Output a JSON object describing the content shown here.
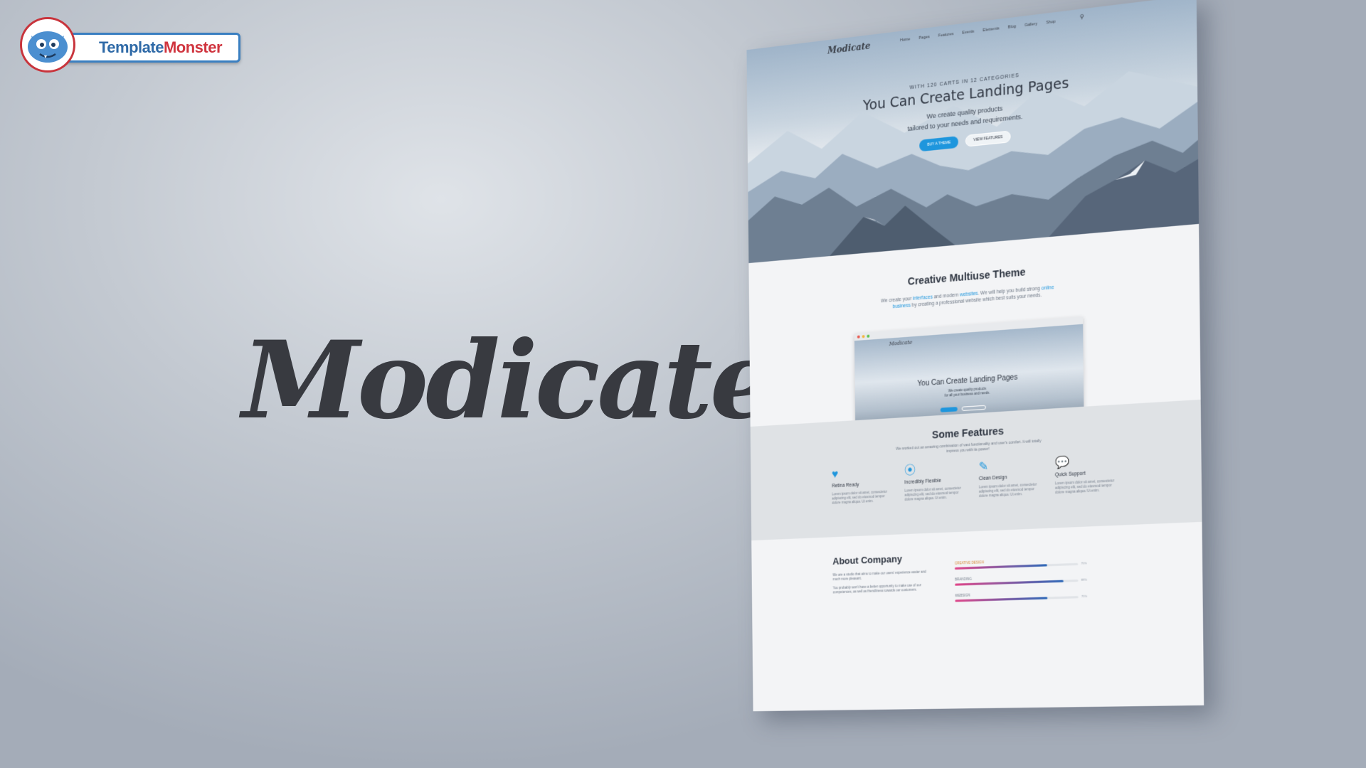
{
  "logo": {
    "part1": "Template",
    "part2": "Monster",
    "icon": "monster-mascot-icon"
  },
  "brand": {
    "title": "Modicate"
  },
  "mockup": {
    "nav": {
      "logo": "Modicate",
      "links": [
        "Home",
        "Pages",
        "Features",
        "Events",
        "Elements",
        "Blog",
        "Gallery",
        "Shop"
      ],
      "search_icon": "search-icon"
    },
    "hero": {
      "kicker": "WITH 120 CARTS IN 12 CATEGORIES",
      "title": "You Can Create Landing Pages",
      "subtitle_line1": "We create quality products",
      "subtitle_line2": "tailored to your needs and requirements.",
      "primary_button": "BUY A THEME",
      "secondary_button": "VIEW FEATURES"
    },
    "multiuse": {
      "title": "Creative Multiuse Theme",
      "desc_a": "We create your ",
      "desc_link1": "interfaces",
      "desc_b": " and modern ",
      "desc_link2": "websites",
      "desc_c": ". We will help you build strong ",
      "desc_link3": "online business",
      "desc_d": " by creating a professional website which best suits your needs.",
      "preview": {
        "logo": "Modicate",
        "title": "You Can Create Landing Pages",
        "subtitle_line1": "We create quality products",
        "subtitle_line2": "for all your business and needs."
      }
    },
    "features": {
      "title": "Some Features",
      "desc": "We worked out an amazing combination of vast functionality and user's comfort. It will totally impress you with its power!",
      "items": [
        {
          "icon": "heart-pulse-icon",
          "title": "Retina Ready",
          "desc": "Lorem ipsum dolor sit amet, consectetur adipiscing elit, sed do eiusmod tempor dolore magna aliqua. Ut enim."
        },
        {
          "icon": "compass-icon",
          "title": "Incredibly Flexible",
          "desc": "Lorem ipsum dolor sit amet, consectetur adipiscing elit, sed do eiusmod tempor dolore magna aliqua. Ut enim."
        },
        {
          "icon": "edit-icon",
          "title": "Clean Design",
          "desc": "Lorem ipsum dolor sit amet, consectetur adipiscing elit, sed do eiusmod tempor dolore magna aliqua. Ut enim."
        },
        {
          "icon": "chat-bubbles-icon",
          "title": "Quick Support",
          "desc": "Lorem ipsum dolor sit amet, consectetur adipiscing elit, sed do eiusmod tempor dolore magna aliqua. Ut enim."
        }
      ]
    },
    "about": {
      "title": "About Company",
      "p1": "We are a studio that aims to make our users' experience easier and much more pleasant.",
      "p2": "You probably won't have a better opportunity to make use of our competences, as well as friendliness towards our customers.",
      "skills": [
        {
          "label": "CREATIVE DESIGN",
          "percent": 75,
          "pct_label": "75%"
        },
        {
          "label": "BRANDING",
          "percent": 88,
          "pct_label": "88%"
        },
        {
          "label": "WEBSIGN",
          "percent": 75,
          "pct_label": "75%"
        }
      ]
    }
  },
  "colors": {
    "accent": "#1e96dd",
    "brand_red": "#d0353f",
    "brand_blue": "#2f6aa7",
    "text_dark": "#383a40"
  }
}
